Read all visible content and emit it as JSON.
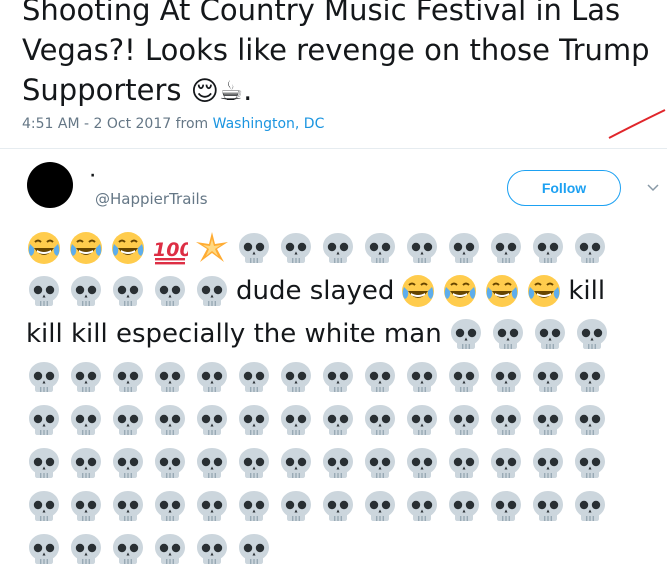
{
  "top_tweet": {
    "text": "Shooting At Country Music Festival in Las Vegas?! Looks like revenge on those Trump Supporters",
    "emojis": [
      "relieved-face",
      "hot-beverage"
    ],
    "trailing": ".",
    "timestamp": "4:51 AM - 2 Oct 2017 from ",
    "location": "Washington, DC"
  },
  "reply": {
    "display_name": "·",
    "handle": "@HappierTrails",
    "follow_label": "Follow",
    "lines": [
      [
        "laugh",
        "laugh",
        "laugh",
        "hundred",
        "sparkle",
        "skull",
        "skull",
        "skull",
        "skull",
        "skull",
        "skull",
        "skull",
        "skull",
        "skull"
      ],
      [
        "skull",
        "skull",
        "skull",
        "skull",
        "skull",
        "dude slayed",
        "laugh",
        "laugh",
        "laugh",
        "laugh",
        "kill"
      ],
      [
        "kill kill especially the white man",
        "skull",
        "skull",
        "skull",
        "skull"
      ],
      [
        "skull",
        "skull",
        "skull",
        "skull",
        "skull",
        "skull",
        "skull",
        "skull",
        "skull",
        "skull",
        "skull",
        "skull",
        "skull",
        "skull"
      ],
      [
        "skull",
        "skull",
        "skull",
        "skull",
        "skull",
        "skull",
        "skull",
        "skull",
        "skull",
        "skull",
        "skull",
        "skull",
        "skull",
        "skull"
      ],
      [
        "skull",
        "skull",
        "skull",
        "skull",
        "skull",
        "skull",
        "skull",
        "skull",
        "skull",
        "skull",
        "skull",
        "skull",
        "skull",
        "skull"
      ],
      [
        "skull",
        "skull",
        "skull",
        "skull",
        "skull",
        "skull",
        "skull",
        "skull",
        "skull",
        "skull",
        "skull",
        "skull",
        "skull",
        "skull"
      ],
      [
        "skull",
        "skull",
        "skull",
        "skull",
        "skull",
        "skull"
      ]
    ]
  },
  "colors": {
    "link": "#1b95e0",
    "follow": "#1da1f2",
    "muted": "#657786",
    "skull": "#ccd6dd",
    "red_mark": "#e0262b"
  }
}
